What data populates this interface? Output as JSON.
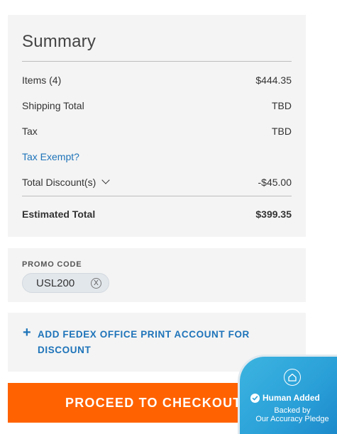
{
  "summary": {
    "title": "Summary",
    "items_label": "Items (4)",
    "items_value": "$444.35",
    "shipping_label": "Shipping Total",
    "shipping_value": "TBD",
    "tax_label": "Tax",
    "tax_value": "TBD",
    "tax_exempt_link": "Tax Exempt?",
    "discount_label": "Total Discount(s)",
    "discount_value": "-$45.00",
    "estimated_label": "Estimated Total",
    "estimated_value": "$399.35"
  },
  "promo": {
    "label": "PROMO CODE",
    "code": "USL200",
    "remove_glyph": "X"
  },
  "account": {
    "plus_glyph": "+",
    "add_label": "ADD FEDEX OFFICE PRINT ACCOUNT FOR DISCOUNT"
  },
  "checkout": {
    "button_label": "PROCEED TO CHECKOUT"
  },
  "badge": {
    "title": "Human Added",
    "line1": "Backed by",
    "line2": "Our Accuracy Pledge"
  },
  "colors": {
    "accent_blue": "#1d73b9",
    "checkout_orange": "#ff6200",
    "badge_blue": "#2aa0d8"
  },
  "icons": {
    "discount_toggle": "chevron-down-icon",
    "promo_remove": "close-circle-icon",
    "add_account": "plus-icon",
    "badge_logo": "house-icon",
    "badge_check": "check-circle-icon"
  }
}
